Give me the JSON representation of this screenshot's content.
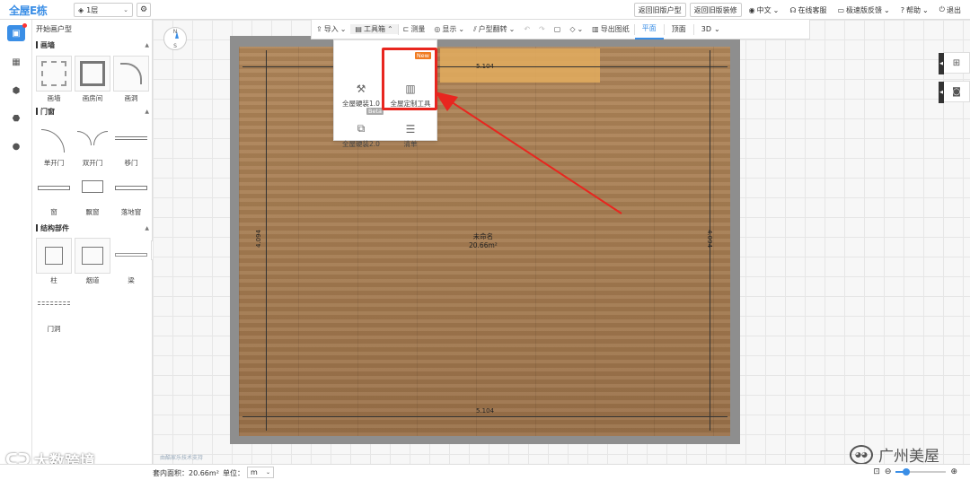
{
  "app": {
    "logo": "全屋E栋"
  },
  "topbar": {
    "floor": "1层",
    "buttons": [
      "返回旧版户型",
      "返回旧版装修"
    ],
    "links": [
      {
        "icon": "globe-icon",
        "label": "中文"
      },
      {
        "icon": "headset-icon",
        "label": "在线客服"
      },
      {
        "icon": "feedback-icon",
        "label": "极速版反馈"
      },
      {
        "icon": "help-icon",
        "label": "帮助"
      },
      {
        "icon": "power-icon",
        "label": "退出"
      }
    ]
  },
  "panel": {
    "title": "开始画户型",
    "sections": [
      {
        "title": "画墙",
        "items": [
          "画墙",
          "画房间",
          "画洞"
        ]
      },
      {
        "title": "门窗",
        "items": [
          "单开门",
          "双开门",
          "移门",
          "窗",
          "飘窗",
          "落地窗"
        ]
      },
      {
        "title": "结构部件",
        "items": [
          "柱",
          "烟道",
          "梁",
          "门洞"
        ]
      }
    ]
  },
  "toolbar": {
    "items": [
      {
        "label": "导入"
      },
      {
        "label": "工具箱"
      },
      {
        "label": "测量"
      },
      {
        "label": "显示"
      },
      {
        "label": "户型翻转"
      },
      {
        "label": "导出图纸"
      }
    ],
    "views": [
      "平面",
      "顶面",
      "3D"
    ]
  },
  "dropdown": {
    "items": [
      {
        "label": "全屋硬装1.0",
        "badge": ""
      },
      {
        "label": "全屋定制工具",
        "badge": "New"
      },
      {
        "label": "全屋硬装2.0",
        "badge": "Beta"
      },
      {
        "label": "清单",
        "badge": ""
      }
    ]
  },
  "room": {
    "dim_top": "5.104",
    "dim_bottom": "5.104",
    "dim_left": "4.094",
    "dim_right": "4.094",
    "area_name": "未命名",
    "area_value": "20.66m²"
  },
  "canvas": {
    "compass_n": "N",
    "compass_s": "S",
    "tech_support": "由酷家乐技术支持"
  },
  "status": {
    "area": "套内面积：20.66m²",
    "unit_label": "单位：",
    "unit_value": "m"
  },
  "watermark": {
    "left": "大数跨境",
    "right": "广州美屋"
  },
  "colors": {
    "accent": "#3a8ee6",
    "highlight": "#e8261f",
    "badge_new": "#f07b22"
  }
}
